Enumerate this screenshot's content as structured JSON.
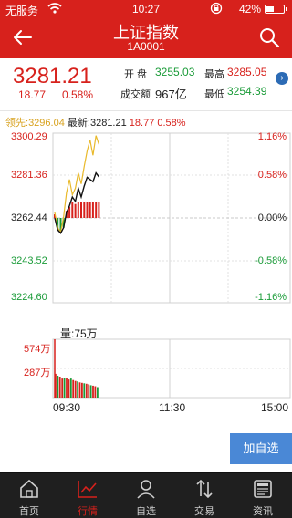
{
  "status": {
    "carrier": "无服务",
    "time": "10:27",
    "battery": "42%"
  },
  "header": {
    "title": "上证指数",
    "code": "1A0001"
  },
  "quote": {
    "price": "3281.21",
    "change": "18.77",
    "change_pct": "0.58%",
    "open_label": "开  盘",
    "open": "3255.03",
    "high_label": "最高",
    "high": "3285.05",
    "turnover_label": "成交额",
    "turnover": "967亿",
    "low_label": "最低",
    "low": "3254.39"
  },
  "info_line": {
    "lead_label": "领先:",
    "lead": "3296.04",
    "latest_label": "最新:",
    "latest": "3281.21",
    "change": "18.77",
    "change_pct": "0.58%"
  },
  "chart": {
    "y_left": [
      "3300.29",
      "3281.36",
      "3262.44",
      "3243.52",
      "3224.60"
    ],
    "y_right": [
      "1.16%",
      "0.58%",
      "0.00%",
      "-0.58%",
      "-1.16%"
    ],
    "volume_title": "量:75万",
    "volume_ticks": [
      "574万",
      "287万"
    ],
    "x_labels": [
      "09:30",
      "11:30",
      "15:00"
    ]
  },
  "chart_data": {
    "type": "line",
    "title": "",
    "xlabel": "",
    "ylabel": "",
    "x_range": [
      "09:30",
      "15:00"
    ],
    "ylim": [
      3224.6,
      3300.29
    ],
    "series": [
      {
        "name": "",
        "color": "#000000",
        "x": [
          "09:30",
          "09:33",
          "09:36",
          "09:39",
          "09:42",
          "09:45",
          "09:48",
          "09:51",
          "09:54",
          "09:57",
          "10:00",
          "10:03",
          "10:06",
          "10:09",
          "10:12",
          "10:15"
        ],
        "values": [
          3262.44,
          3257.0,
          3255.5,
          3258.0,
          3265.0,
          3268.0,
          3272.0,
          3270.0,
          3276.0,
          3272.0,
          3277.0,
          3281.0,
          3280.0,
          3279.0,
          3283.0,
          3281.21
        ]
      },
      {
        "name": "",
        "color": "#e9b92a",
        "x": [
          "09:30",
          "09:33",
          "09:36",
          "09:39",
          "09:42",
          "09:45",
          "09:48",
          "09:51",
          "09:54",
          "09:57",
          "10:00",
          "10:03",
          "10:06",
          "10:09",
          "10:12",
          "10:15"
        ],
        "values": [
          3265.0,
          3258.0,
          3256.0,
          3263.0,
          3274.0,
          3280.0,
          3273.0,
          3276.0,
          3283.0,
          3278.0,
          3286.0,
          3293.0,
          3298.0,
          3291.0,
          3300.0,
          3296.04
        ]
      }
    ],
    "volume": {
      "ylim": [
        0,
        574
      ],
      "unit": "万",
      "values": [
        250,
        230,
        220,
        200,
        210,
        205,
        190,
        200,
        185,
        175,
        170,
        160,
        155,
        150,
        145,
        140,
        130,
        125,
        120,
        110
      ]
    }
  },
  "actions": {
    "add_watchlist": "加自选"
  },
  "tabbar": {
    "items": [
      {
        "label": "首页",
        "icon": "home-icon"
      },
      {
        "label": "行情",
        "icon": "market-chart-icon"
      },
      {
        "label": "自选",
        "icon": "user-icon"
      },
      {
        "label": "交易",
        "icon": "trade-arrows-icon"
      },
      {
        "label": "资讯",
        "icon": "news-icon"
      }
    ]
  },
  "colors": {
    "accent": "#d7211c",
    "up": "#d7211c",
    "down": "#1a9b38",
    "button": "#4a88d6"
  }
}
